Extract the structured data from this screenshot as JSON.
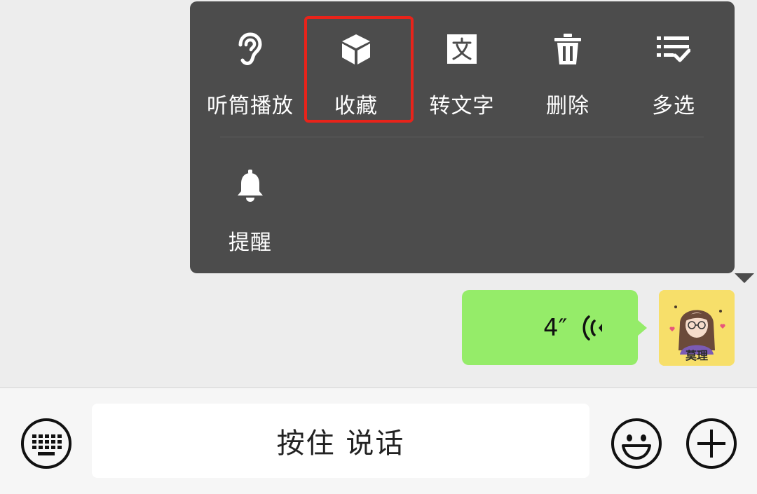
{
  "menu": {
    "items": [
      {
        "label": "听筒播放",
        "icon": "ear-icon"
      },
      {
        "label": "收藏",
        "icon": "cube-icon"
      },
      {
        "label": "转文字",
        "icon": "text-convert-icon"
      },
      {
        "label": "删除",
        "icon": "trash-icon"
      },
      {
        "label": "多选",
        "icon": "multiselect-icon"
      },
      {
        "label": "提醒",
        "icon": "bell-icon"
      }
    ],
    "highlight_color": "#e8231a"
  },
  "message": {
    "duration": "4″",
    "bubble_color": "#95ec69"
  },
  "avatar": {
    "name": "莫理"
  },
  "input_bar": {
    "hold_to_talk": "按住 说话"
  }
}
